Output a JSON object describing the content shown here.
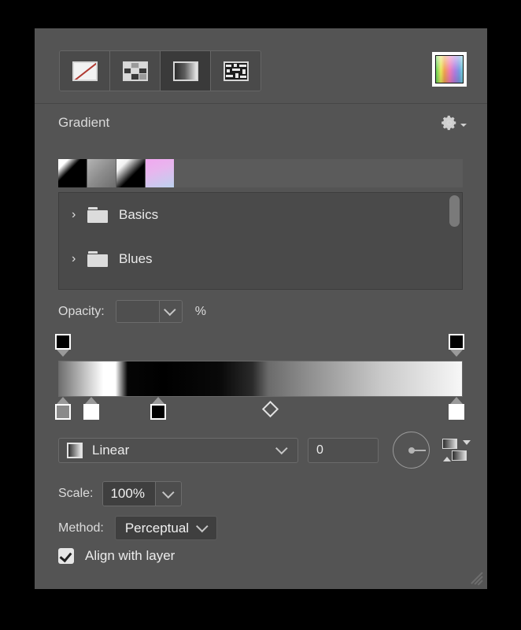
{
  "panel": {
    "background_color": "#545454",
    "title": "Gradient"
  },
  "toolbar": {
    "fill_types": [
      {
        "name": "none",
        "label": "Solid / None",
        "icon": "no-fill-icon",
        "active": false
      },
      {
        "name": "pattern",
        "label": "Pattern",
        "icon": "pattern-icon",
        "active": false
      },
      {
        "name": "gradient",
        "label": "Gradient",
        "icon": "gradient-icon",
        "active": true
      },
      {
        "name": "noise",
        "label": "Noise",
        "icon": "noise-icon",
        "active": false
      }
    ],
    "color_picker": {
      "icon": "color-picker-swatch",
      "label": "Color"
    }
  },
  "header": {
    "title": "Gradient",
    "menu_icon": "gear-icon",
    "menu_arrow_icon": "chevron-down-icon"
  },
  "presets": {
    "swatches": [
      {
        "name": "white-to-black-sharp",
        "label": "White to Black"
      },
      {
        "name": "gray-gradient",
        "label": "Gray"
      },
      {
        "name": "white-to-black-soft",
        "label": "Foreground to Background"
      },
      {
        "name": "pink-to-blue",
        "label": "Pink to Blue"
      }
    ]
  },
  "gradient_list": {
    "items": [
      {
        "label": "Basics",
        "icon": "folder-icon",
        "expander": "chevron-right-icon",
        "expanded": false
      },
      {
        "label": "Blues",
        "icon": "folder-icon",
        "expander": "chevron-right-icon",
        "expanded": false
      }
    ],
    "scrollbar": {
      "name": "vertical-scrollbar"
    }
  },
  "opacity": {
    "label": "Opacity:",
    "value": "",
    "placeholder": "",
    "unit": "%",
    "dropdown_icon": "chevron-down-icon"
  },
  "editor": {
    "top_stops": [
      {
        "position_pct": 0,
        "color": "#000000",
        "selected": true,
        "name": "opacity-stop"
      },
      {
        "position_pct": 100,
        "color": "#000000",
        "selected": true,
        "name": "opacity-stop"
      }
    ],
    "bottom_stops": [
      {
        "position_pct": 0,
        "color": "#8a8a8a",
        "selected": true,
        "name": "color-stop"
      },
      {
        "position_pct": 7,
        "color": "#ffffff",
        "selected": false,
        "name": "color-stop"
      },
      {
        "position_pct": 24,
        "color": "#000000",
        "selected": true,
        "name": "color-stop"
      },
      {
        "position_pct": 100,
        "color": "#ffffff",
        "selected": false,
        "name": "color-stop"
      }
    ],
    "midpoints": [
      {
        "position_pct": 52,
        "name": "midpoint-marker"
      }
    ],
    "gradient_css": "linear-gradient(to right, #6e6e6e 0%, #ffffff 11%, #ffffff 14%, #050505 17%, #000000 26%, #090909 40%, #2a2a2a 48%, #6b6b6b 52%, #8f8f8f 62%, #c9c9c9 80%, #f7f7f7 100%)"
  },
  "shape": {
    "label": "Linear",
    "swatch_icon": "gradient-swatch-icon",
    "dropdown_icon": "chevron-down-icon",
    "angle_value": "0",
    "angle_dial_icon": "angle-dial-icon",
    "reverse_icon": "reverse-gradient-icon"
  },
  "scale": {
    "label": "Scale:",
    "value": "100%",
    "dropdown_icon": "chevron-down-icon"
  },
  "method": {
    "label": "Method:",
    "value": "Perceptual",
    "dropdown_icon": "chevron-down-icon"
  },
  "align": {
    "label": "Align with layer",
    "checked": true,
    "check_icon": "checkmark-icon"
  },
  "resize": {
    "grip_icon": "resize-grip-icon"
  }
}
